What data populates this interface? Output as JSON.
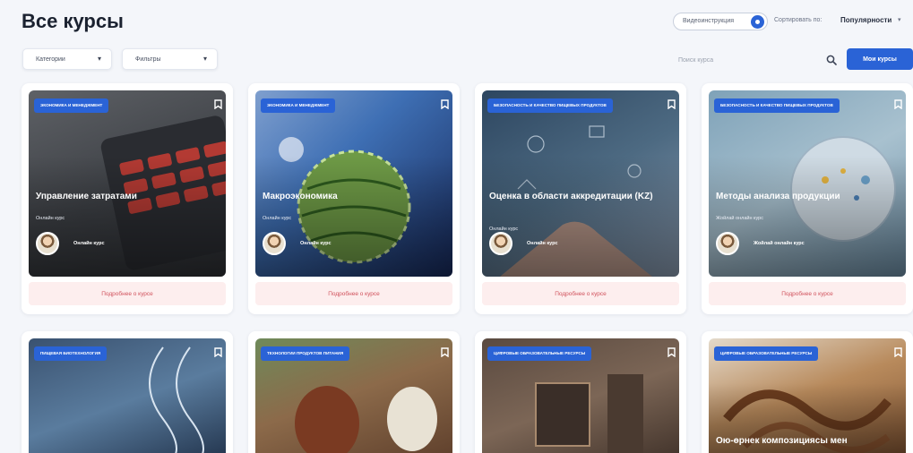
{
  "page": {
    "title": "Все курсы"
  },
  "toolbar": {
    "view_toggle_label": "Видеоинструкция",
    "sort_label": "Сортировать по:",
    "sort_value": "Популярности"
  },
  "filters": {
    "category": "Категории",
    "filter": "Фильтры"
  },
  "search": {
    "placeholder": "Поиск курса"
  },
  "my_courses_label": "Мои курсы",
  "details_label": "Подробнее о курсе",
  "cards": [
    {
      "tag": "ЭКОНОМИКА И МЕНЕДЖМЕНТ",
      "title": "Управление затратами",
      "type": "Онлайн курс",
      "author": "Онлайн курс"
    },
    {
      "tag": "ЭКОНОМИКА И МЕНЕДЖМЕНТ",
      "title": "Макроэкономика",
      "type": "Онлайн курс",
      "author": "Онлайн курс"
    },
    {
      "tag": "БЕЗОПАСНОСТЬ И КАЧЕСТВО ПИЩЕВЫХ ПРОДУКТОВ",
      "title": "Оценка в области аккредитации (KZ)",
      "type": "Онлайн курс",
      "author": "Онлайн курс"
    },
    {
      "tag": "БЕЗОПАСНОСТЬ И КАЧЕСТВО ПИЩЕВЫХ ПРОДУКТОВ",
      "title": "Методы анализа продукции",
      "type": "Жойлай онлайн курс",
      "author": "Жойлай онлайн курс"
    },
    {
      "tag": "ПИЩЕВАЯ БИОТЕХНОЛОГИЯ",
      "title": "",
      "type": "",
      "author": ""
    },
    {
      "tag": "ТЕХНОЛОГИИ ПРОДУКТОВ ПИТАНИЯ",
      "title": "",
      "type": "",
      "author": ""
    },
    {
      "tag": "ЦИФРОВЫЕ ОБРАЗОВАТЕЛЬНЫЕ РЕСУРСЫ",
      "title": "",
      "type": "",
      "author": ""
    },
    {
      "tag": "ЦИФРОВЫЕ ОБРАЗОВАТЕЛЬНЫЕ РЕСУРСЫ",
      "title": "Ою-өрнек композициясы мен",
      "type": "",
      "author": ""
    }
  ]
}
